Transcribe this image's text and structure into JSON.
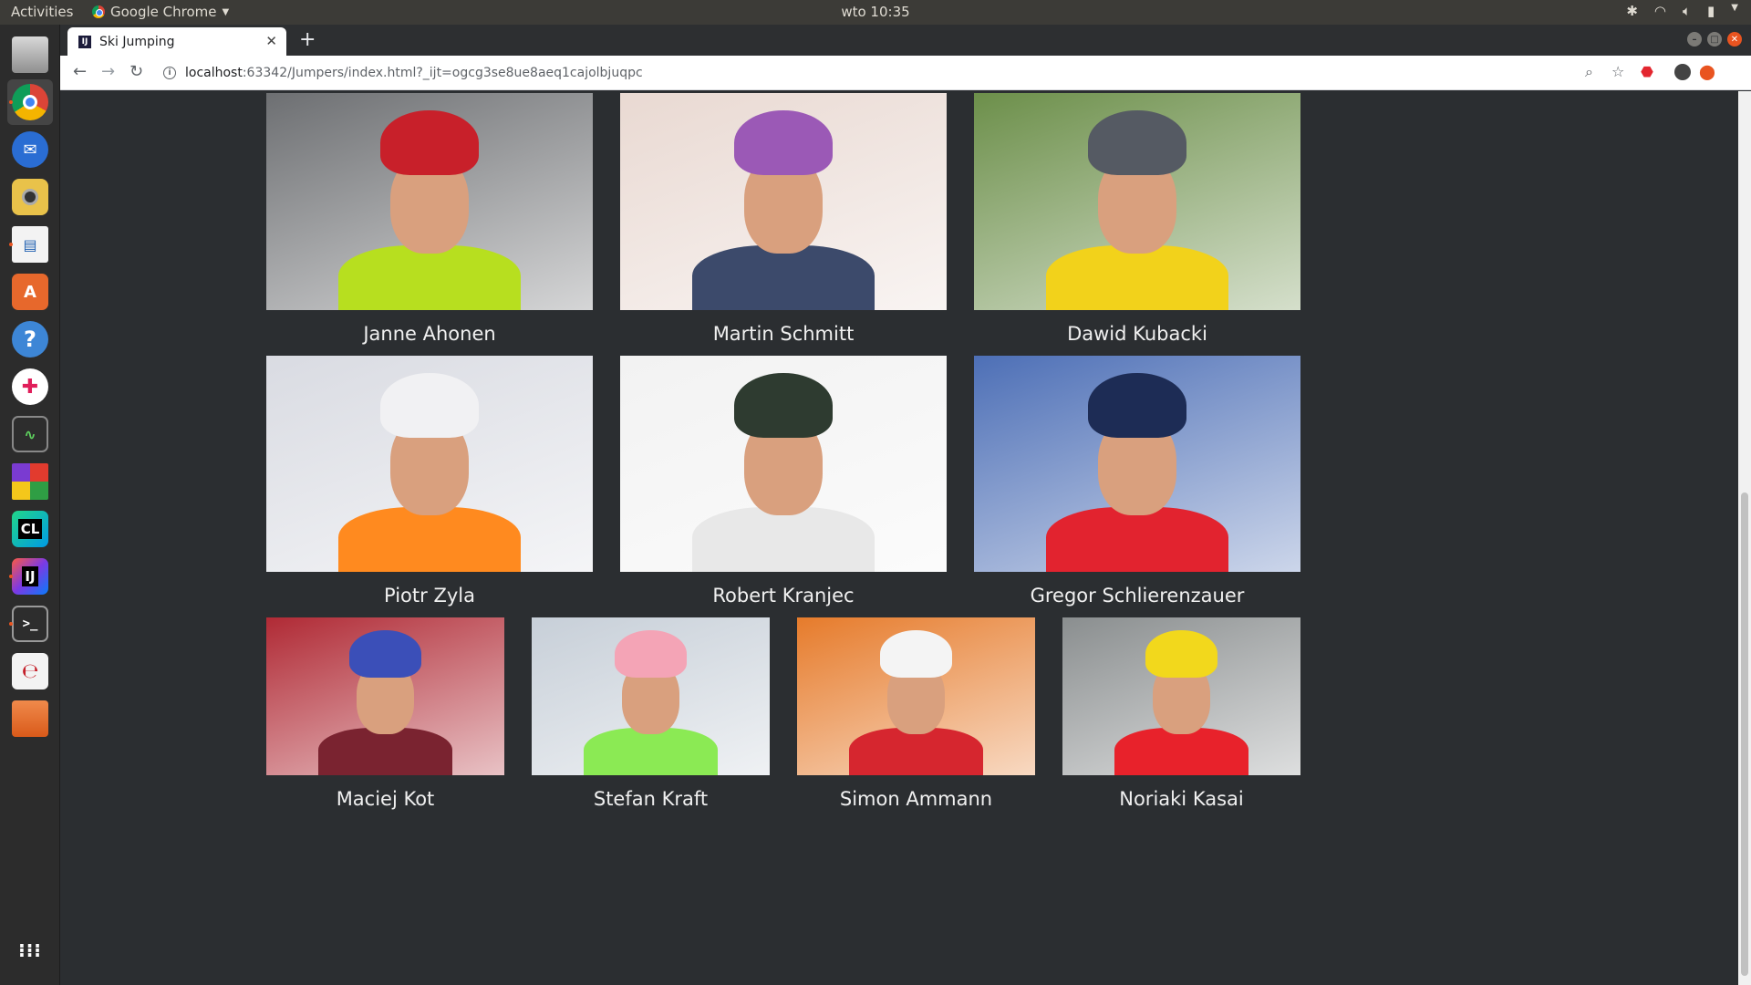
{
  "system": {
    "activities_label": "Activities",
    "app_name": "Google Chrome",
    "clock": "wto 10:35"
  },
  "browser": {
    "tab_title": "Ski Jumping",
    "url_host": "localhost",
    "url_rest": ":63342/Jumpers/index.html?_ijt=ogcg3se8ue8aeq1cajolbjuqpc",
    "favicon_text": "IJ"
  },
  "dock": {
    "items": [
      "files-icon",
      "chrome-icon",
      "thunderbird-icon",
      "rhythmbox-icon",
      "writer-icon",
      "software-icon",
      "help-icon",
      "slack-icon",
      "system-monitor-icon",
      "winapp-icon",
      "clion-icon",
      "intellij-icon",
      "terminal-icon",
      "editor-icon",
      "folder-icon",
      "app-grid-icon"
    ]
  },
  "jumpers": [
    {
      "name": "Janne Ahonen",
      "bg": "#6d6f72",
      "helmet": "#c8202a",
      "body": "#b7df1f"
    },
    {
      "name": "Martin Schmitt",
      "bg": "#e9d9d2",
      "helmet": "#9b59b6",
      "body": "#3c4a6b"
    },
    {
      "name": "Dawid Kubacki",
      "bg": "#6c8f4a",
      "helmet": "#555a63",
      "body": "#f2d21b"
    },
    {
      "name": "Piotr Zyla",
      "bg": "#d9dbe2",
      "helmet": "#f1f1f3",
      "body": "#ff8a1f"
    },
    {
      "name": "Robert Kranjec",
      "bg": "#f2f2f2",
      "helmet": "#2e3b30",
      "body": "#e8e8e8"
    },
    {
      "name": "Gregor Schlierenzauer",
      "bg": "#4d6fb6",
      "helmet": "#1d2c55",
      "body": "#e2232f"
    },
    {
      "name": "Maciej Kot",
      "bg": "#b02a35",
      "helmet": "#3b4fb8",
      "body": "#7a2330"
    },
    {
      "name": "Stefan Kraft",
      "bg": "#c7cfd8",
      "helmet": "#f4a4b6",
      "body": "#8bea54"
    },
    {
      "name": "Simon Ammann",
      "bg": "#e67b2b",
      "helmet": "#f4f4f4",
      "body": "#d6262f"
    },
    {
      "name": "Noriaki Kasai",
      "bg": "#8a8e8f",
      "helmet": "#f2d81c",
      "body": "#e8222b"
    }
  ]
}
